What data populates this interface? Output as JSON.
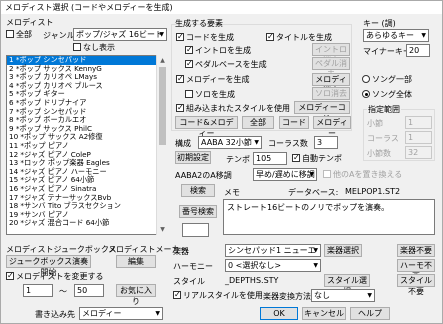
{
  "window": {
    "title": "メロディスト選択 (コードやメロディーを生成)"
  },
  "melodist": {
    "header": "メロディスト",
    "all_label": "全部",
    "genre_label": "ジャンル",
    "genre_value": "ポップ/ジャズ 16ビート",
    "hide_label": "なし表示",
    "items": [
      "1 *ポップ シンセパッド",
      "2 *ポップ サックス KennyG",
      "3 *ポップ カリオペ LMays",
      "4 *ポップ カリオペ ブルース",
      "5 *ポップ ギター",
      "6 *ポップ ドリブナイア",
      "7 *ポップ シンセパッド",
      "8 *ポップ ボーカルエオ",
      "9 *ポップ サックス PhilC",
      "10 *ポップ サックス A2修復",
      "11 *ポップ ピアノ",
      "12 *ジャズ ピアノ ColeP",
      "13 *ロック ポップ楽器 Eagles",
      "14 *ジャズ ピアノ ハーモニー",
      "15 *ジャズ ピアノ 64小節",
      "16 *ジャズ ピアノ Sinatra",
      "17 *ジャズ テナーサックスBvb",
      "18 *サンバ Tito ブラスセクション",
      "19 *サンバ ピアノ",
      "20 *ジャズ 混合コード 64小節"
    ],
    "selected_index": 0
  },
  "generate": {
    "header": "生成する要素",
    "chord_label": "コードを生成",
    "title_label": "タイトルを生成",
    "intro_label": "イントロを生成",
    "intro_erase": "イントロ消去",
    "pedal_label": "ペダルベースを生成",
    "pedal_erase": "ペダル消去",
    "melody_label": "メロディーを生成",
    "melody_erase": "メロディ消去",
    "solo_label": "ソロを生成",
    "solo_erase": "ソロ消去",
    "embedded_label": "組み込まれたスタイルを使用",
    "melody_chord_btn": "メロディーコード",
    "chord_melody_btn": "コード&メロディー",
    "all_btn": "全部",
    "chord_btn": "コード",
    "melody_btn": "メロディー"
  },
  "key": {
    "header": "キー (調)",
    "key_value": "あらゆるキー",
    "minor_label": "マイナーキー",
    "minor_value": "20",
    "song_part_label": "ソング一部",
    "song_all_label": "ソング全体",
    "range_header": "指定範囲",
    "bar_label": "小節",
    "bar_value": "1",
    "chorus_label": "コーラス",
    "chorus_value": "1",
    "num_bars_label": "小節数",
    "num_bars_value": "32"
  },
  "form": {
    "structure_label": "構成",
    "structure_value": "AABA 32小節",
    "chorus_count_label": "コーラス数",
    "chorus_count_value": "3",
    "init_btn": "初期設定",
    "tempo_label": "テンポ",
    "tempo_value": "105",
    "auto_tempo_label": "自動テンポ",
    "aaba_label": "AABA2のA移調",
    "aaba_value": "早め/遅めに移調",
    "replace_label": "他のAを置き換える"
  },
  "search": {
    "search_btn": "検索",
    "memo_label": "メモ",
    "database_label": "データベース:",
    "database_value": "MELPOP1.ST2",
    "number_search_btn": "番号検索",
    "memo_text": "ストレート16ビートのノリでポップを演奏。"
  },
  "jukebox": {
    "header": "メロディストジュークボックス",
    "start_btn": "ジュークボックス演奏開始",
    "change_label": "メロディストを変更する",
    "from_value": "1",
    "tilde": "〜",
    "to_value": "50"
  },
  "maker": {
    "header": "メロディストメーカー",
    "edit_btn": "編集",
    "favorite_btn": "お気に入り"
  },
  "instruments": {
    "instrument_label": "楽器",
    "instrument_value": "シンセパッド1 ニューエイジ",
    "instrument_select_btn": "楽器選択",
    "instrument_none_btn": "楽器不要",
    "harmony_label": "ハーモニー",
    "harmony_value": "0 <選択なし>",
    "harmony_none_btn": "ハーモ不要",
    "style_label": "スタイル",
    "style_value": "_DEPTHS.STY",
    "style_select_btn": "スタイル選択",
    "style_none_btn": "スタイル不要",
    "real_style_label": "リアルスタイルを使用",
    "instrument_convert_label": "楽器変換方法",
    "instrument_convert_value": "なし"
  },
  "footer": {
    "write_to_label": "書き込み先",
    "write_to_value": "メロディー",
    "ok_btn": "OK",
    "cancel_btn": "キャンセル",
    "help_btn": "ヘルプ"
  }
}
